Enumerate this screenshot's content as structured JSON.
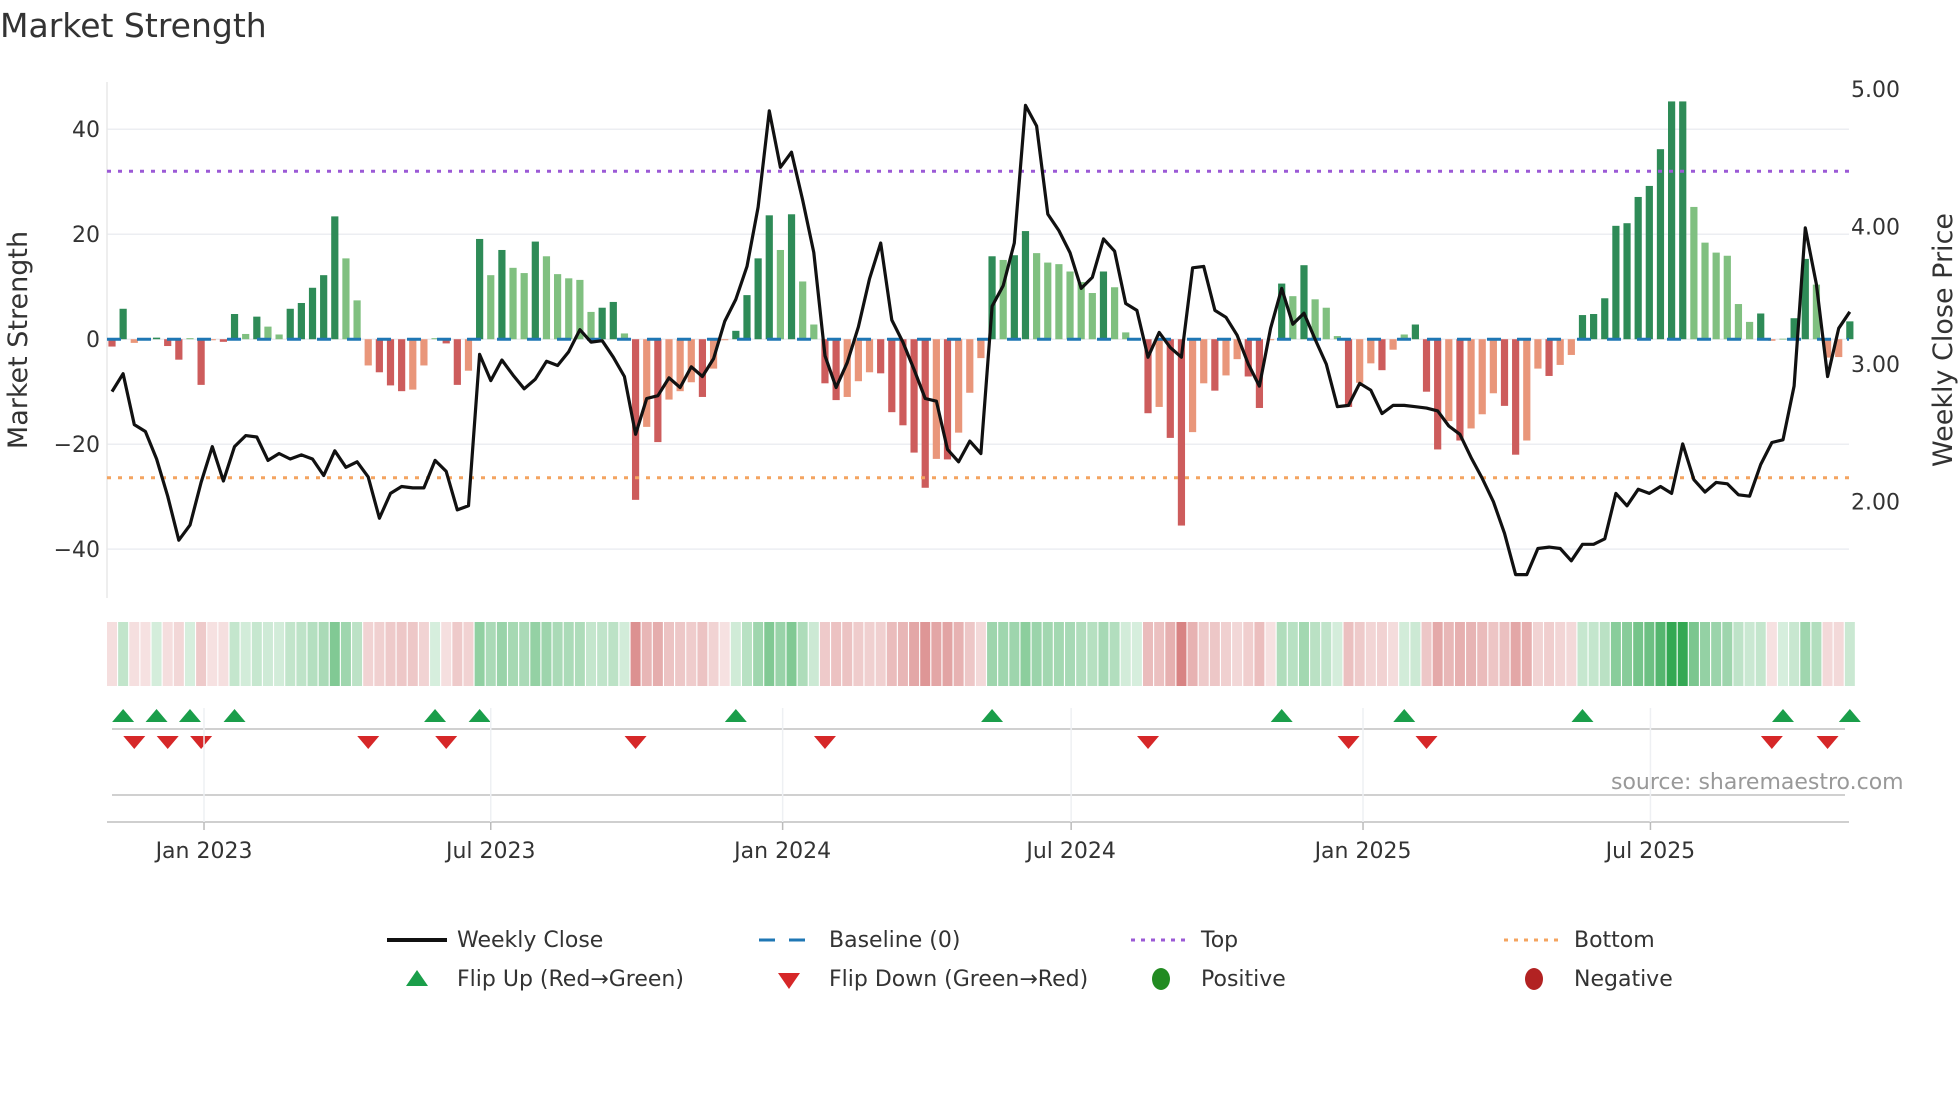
{
  "title": "Market Strength",
  "source_note": "source: sharemaestro.com",
  "colors": {
    "bar_pos_strong": "#2e8b57",
    "bar_pos_weak": "#80c080",
    "bar_neg_strong": "#cd5c5c",
    "bar_neg_weak": "#e9967a",
    "close_line": "#111111",
    "baseline": "#1f77b4",
    "top": "#9b59d6",
    "bottom": "#f4a460",
    "flip_up": "#1a9e4a",
    "flip_down": "#d62728",
    "positive": "#228b22",
    "negative": "#b22222"
  },
  "legend": {
    "weekly_close": "Weekly Close",
    "baseline": "Baseline (0)",
    "top": "Top",
    "bottom": "Bottom",
    "flip_up": "Flip Up (Red→Green)",
    "flip_down": "Flip Down (Green→Red)",
    "positive": "Positive",
    "negative": "Negative"
  },
  "chart_data": {
    "type": "bar",
    "title": "Market Strength",
    "ylabel": "Market Strength",
    "y2label": "Weekly Close Price",
    "x_unit": "week index",
    "ylim": [
      -49.3,
      49.0
    ],
    "y2lim": [
      1.3,
      5.05
    ],
    "yticks": [
      {
        "v": 40,
        "label": "40"
      },
      {
        "v": 20,
        "label": "20"
      },
      {
        "v": 0,
        "label": "0"
      },
      {
        "v": -20,
        "label": "−20"
      },
      {
        "v": -40,
        "label": "−40"
      }
    ],
    "y2ticks": [
      {
        "v": 5,
        "label": "5.00"
      },
      {
        "v": 4,
        "label": "4.00"
      },
      {
        "v": 3,
        "label": "3.00"
      },
      {
        "v": 2,
        "label": "2.00"
      }
    ],
    "xticks": [
      {
        "x": 8.26,
        "label": "Jan 2023"
      },
      {
        "x": 34.0,
        "label": "Jul 2023"
      },
      {
        "x": 60.2,
        "label": "Jan 2024"
      },
      {
        "x": 86.1,
        "label": "Jul 2024"
      },
      {
        "x": 112.3,
        "label": "Jan 2025"
      },
      {
        "x": 138.1,
        "label": "Jul 2025"
      }
    ],
    "top_level": 32.0,
    "bottom_level": -26.4,
    "baseline": 0,
    "grid": true,
    "legend_position": "bottom",
    "strength": [
      -1.4,
      5.8,
      -0.7,
      -0.2,
      0.3,
      -1.3,
      -3.9,
      0.2,
      -8.7,
      -0.2,
      -0.5,
      4.8,
      1.0,
      4.3,
      2.4,
      0.9,
      5.8,
      6.9,
      9.8,
      12.2,
      23.4,
      15.4,
      7.4,
      -5.0,
      -6.3,
      -8.8,
      -9.9,
      -9.6,
      -5.0,
      0.2,
      -0.8,
      -8.7,
      -6.0,
      19.1,
      12.2,
      17.0,
      13.6,
      12.6,
      18.6,
      15.8,
      12.4,
      11.6,
      11.3,
      5.2,
      6.0,
      7.1,
      1.1,
      -30.6,
      -16.7,
      -19.6,
      -11.5,
      -9.9,
      -8.2,
      -11.0,
      -5.6,
      -0.2,
      1.6,
      8.4,
      15.4,
      23.6,
      17.0,
      23.8,
      11.0,
      2.8,
      -8.4,
      -11.6,
      -11.0,
      -8.0,
      -6.3,
      -6.5,
      -13.9,
      -16.4,
      -21.6,
      -28.3,
      -22.8,
      -22.9,
      -17.8,
      -10.2,
      -3.6,
      15.8,
      15.1,
      16.0,
      20.6,
      16.4,
      14.6,
      14.3,
      12.9,
      10.9,
      8.8,
      12.9,
      9.9,
      1.3,
      0.2,
      -14.1,
      -12.9,
      -18.8,
      -35.5,
      -17.7,
      -8.4,
      -9.8,
      -6.9,
      -3.8,
      -7.1,
      -13.1,
      -0.2,
      10.6,
      8.2,
      14.1,
      7.6,
      6.0,
      0.6,
      -12.9,
      -8.3,
      -4.6,
      -5.9,
      -2.0,
      0.9,
      2.8,
      -10.0,
      -21.0,
      -15.6,
      -19.3,
      -17.0,
      -14.3,
      -10.3,
      -12.7,
      -22.0,
      -19.3,
      -5.6,
      -7.0,
      -4.9,
      -3.0,
      4.6,
      4.8,
      7.8,
      21.6,
      22.1,
      27.1,
      29.2,
      36.2,
      45.3,
      45.3,
      25.2,
      18.4,
      16.5,
      15.9,
      6.7,
      3.3,
      4.9,
      -0.3,
      0.1,
      4.0,
      15.3,
      10.4,
      -3.5,
      -3.4,
      3.4
    ],
    "weekly_close": [
      2.8,
      2.93,
      2.56,
      2.51,
      2.31,
      2.04,
      1.72,
      1.83,
      2.14,
      2.4,
      2.15,
      2.4,
      2.48,
      2.47,
      2.3,
      2.35,
      2.31,
      2.34,
      2.31,
      2.19,
      2.37,
      2.25,
      2.29,
      2.18,
      1.88,
      2.06,
      2.11,
      2.1,
      2.1,
      2.3,
      2.22,
      1.94,
      1.97,
      3.07,
      2.88,
      3.03,
      2.92,
      2.82,
      2.89,
      3.02,
      2.99,
      3.09,
      3.25,
      3.16,
      3.17,
      3.05,
      2.91,
      2.49,
      2.75,
      2.77,
      2.9,
      2.83,
      2.98,
      2.91,
      3.04,
      3.31,
      3.47,
      3.71,
      4.14,
      4.84,
      4.43,
      4.54,
      4.19,
      3.81,
      3.06,
      2.83,
      3.01,
      3.27,
      3.62,
      3.88,
      3.32,
      3.16,
      2.96,
      2.75,
      2.73,
      2.38,
      2.29,
      2.44,
      2.35,
      3.42,
      3.57,
      3.88,
      4.88,
      4.73,
      4.09,
      3.97,
      3.81,
      3.55,
      3.63,
      3.91,
      3.82,
      3.44,
      3.39,
      3.05,
      3.23,
      3.12,
      3.05,
      3.7,
      3.71,
      3.39,
      3.34,
      3.21,
      3.0,
      2.84,
      3.26,
      3.55,
      3.29,
      3.37,
      3.18,
      3.0,
      2.69,
      2.7,
      2.86,
      2.81,
      2.64,
      2.7,
      2.7,
      2.69,
      2.68,
      2.66,
      2.55,
      2.49,
      2.32,
      2.17,
      2.0,
      1.77,
      1.47,
      1.47,
      1.66,
      1.67,
      1.66,
      1.57,
      1.69,
      1.69,
      1.73,
      2.06,
      1.97,
      2.09,
      2.06,
      2.11,
      2.06,
      2.42,
      2.16,
      2.07,
      2.14,
      2.13,
      2.05,
      2.04,
      2.27,
      2.43,
      2.45,
      2.84,
      3.99,
      3.58,
      2.91,
      3.26,
      3.38
    ]
  }
}
